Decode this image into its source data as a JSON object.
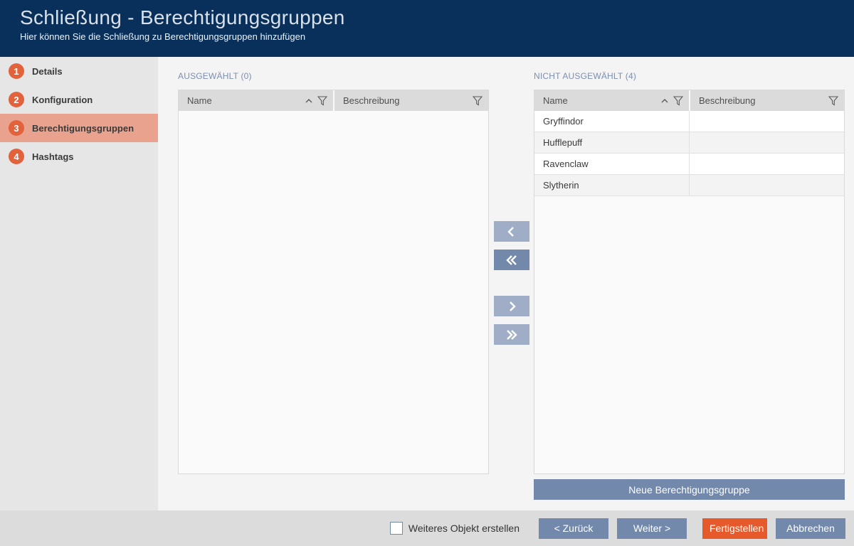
{
  "header": {
    "title": "Schließung - Berechtigungsgruppen",
    "subtitle": "Hier können Sie die Schließung zu Berechtigungsgruppen hinzufügen"
  },
  "sidebar": {
    "active_step": "3",
    "steps": [
      {
        "number": "1",
        "label": "Details"
      },
      {
        "number": "2",
        "label": "Konfiguration"
      },
      {
        "number": "3",
        "label": "Berechtigungsgruppen"
      },
      {
        "number": "4",
        "label": "Hashtags"
      }
    ]
  },
  "selected_panel": {
    "label": "AUSGEWÄHLT (0)",
    "count": 0,
    "columns": {
      "name": "Name",
      "description": "Beschreibung"
    },
    "rows": []
  },
  "unselected_panel": {
    "label": "NICHT AUSGEWÄHLT (4)",
    "count": 4,
    "columns": {
      "name": "Name",
      "description": "Beschreibung"
    },
    "rows": [
      {
        "name": "Gryffindor",
        "description": ""
      },
      {
        "name": "Hufflepuff",
        "description": ""
      },
      {
        "name": "Ravenclaw",
        "description": ""
      },
      {
        "name": "Slytherin",
        "description": ""
      }
    ],
    "new_group_button": "Neue Berechtigungsgruppe"
  },
  "transfer": {
    "icons": [
      "chevron-left",
      "double-chevron-left",
      "chevron-right",
      "double-chevron-right"
    ]
  },
  "footer": {
    "checkbox_label": "Weiteres Objekt erstellen",
    "checkbox_checked": false,
    "back_button": "< Zurück",
    "next_button": "Weiter >",
    "finish_button": "Fertigstellen",
    "cancel_button": "Abbrechen"
  },
  "colors": {
    "header_bg": "#08305A",
    "sidebar_bg": "#E6E6E6",
    "active_step_bg": "#E9A28D",
    "step_circle_orange": "#E2623C",
    "finish_orange": "#E6592B",
    "button_blue": "#7389AB",
    "transfer_button_light": "#9FAEC6",
    "panel_label_blue": "#7B8FB0",
    "table_header_bg": "#DBDBDB",
    "footer_bg": "#DCDCDC"
  }
}
